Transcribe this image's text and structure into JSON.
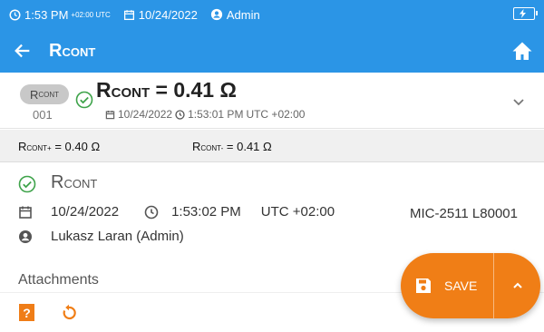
{
  "status": {
    "time": "1:53 PM",
    "timezone": "+02:00 UTC",
    "date": "10/24/2022",
    "user": "Admin"
  },
  "header": {
    "title_main": "R",
    "title_sub": "CONT"
  },
  "result": {
    "tag_main": "R",
    "tag_sub": "CONT",
    "number": "001",
    "value_main": "R",
    "value_sub": "CONT",
    "value_text": " = 0.41 Ω",
    "date": "10/24/2022",
    "time": "1:53:01 PM",
    "timezone": "UTC +02:00"
  },
  "sub_results": [
    {
      "main": "R",
      "sub": "CONT+",
      "value": " = 0.40 Ω"
    },
    {
      "main": "R",
      "sub": "CONT-",
      "value": " = 0.41 Ω"
    }
  ],
  "details": {
    "name_main": "R",
    "name_sub": "CONT",
    "date": "10/24/2022",
    "time": "1:53:02 PM",
    "timezone": "UTC +02:00",
    "device": "MIC-2511 L80001",
    "user": "Lukasz Laran (Admin)"
  },
  "attachments_label": "Attachments",
  "actions": {
    "help_label": "?",
    "save_label": "SAVE"
  },
  "colors": {
    "header_blue": "#2b95e6",
    "accent_orange": "#f07e16",
    "ok_green": "#3ea34a"
  }
}
